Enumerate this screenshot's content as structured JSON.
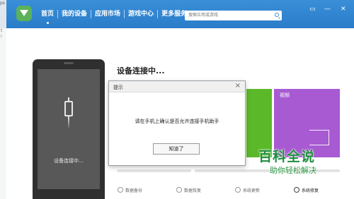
{
  "background": {
    "strip_text": "ps",
    "side_text": [
      "t",
      "i"
    ]
  },
  "header": {
    "nav": [
      "首页",
      "我的设备",
      "应用市场",
      "游戏中心",
      "更多服务"
    ],
    "search_placeholder": "搜索应用或游戏",
    "window_controls": [
      "▭",
      "—",
      "✕"
    ]
  },
  "phone": {
    "status_label": "设备连接中..."
  },
  "main": {
    "title": "设备连接中...",
    "tile_purple_label": "视频",
    "bottom_items": [
      "数据备份",
      "数据恢复",
      "系统更新",
      "系统修复"
    ]
  },
  "dialog": {
    "title": "提示",
    "message": "请在手机上确认是否允许连接手机助手",
    "button": "知道了",
    "close": "×"
  },
  "watermark": {
    "title": "百科全说",
    "subtitle": "助你轻松解决"
  },
  "colors": {
    "header_blue": "#2a7cc9",
    "tile_green": "#5bb829",
    "tile_purple": "#a85ad2",
    "watermark_green": "#1e8e3e"
  }
}
